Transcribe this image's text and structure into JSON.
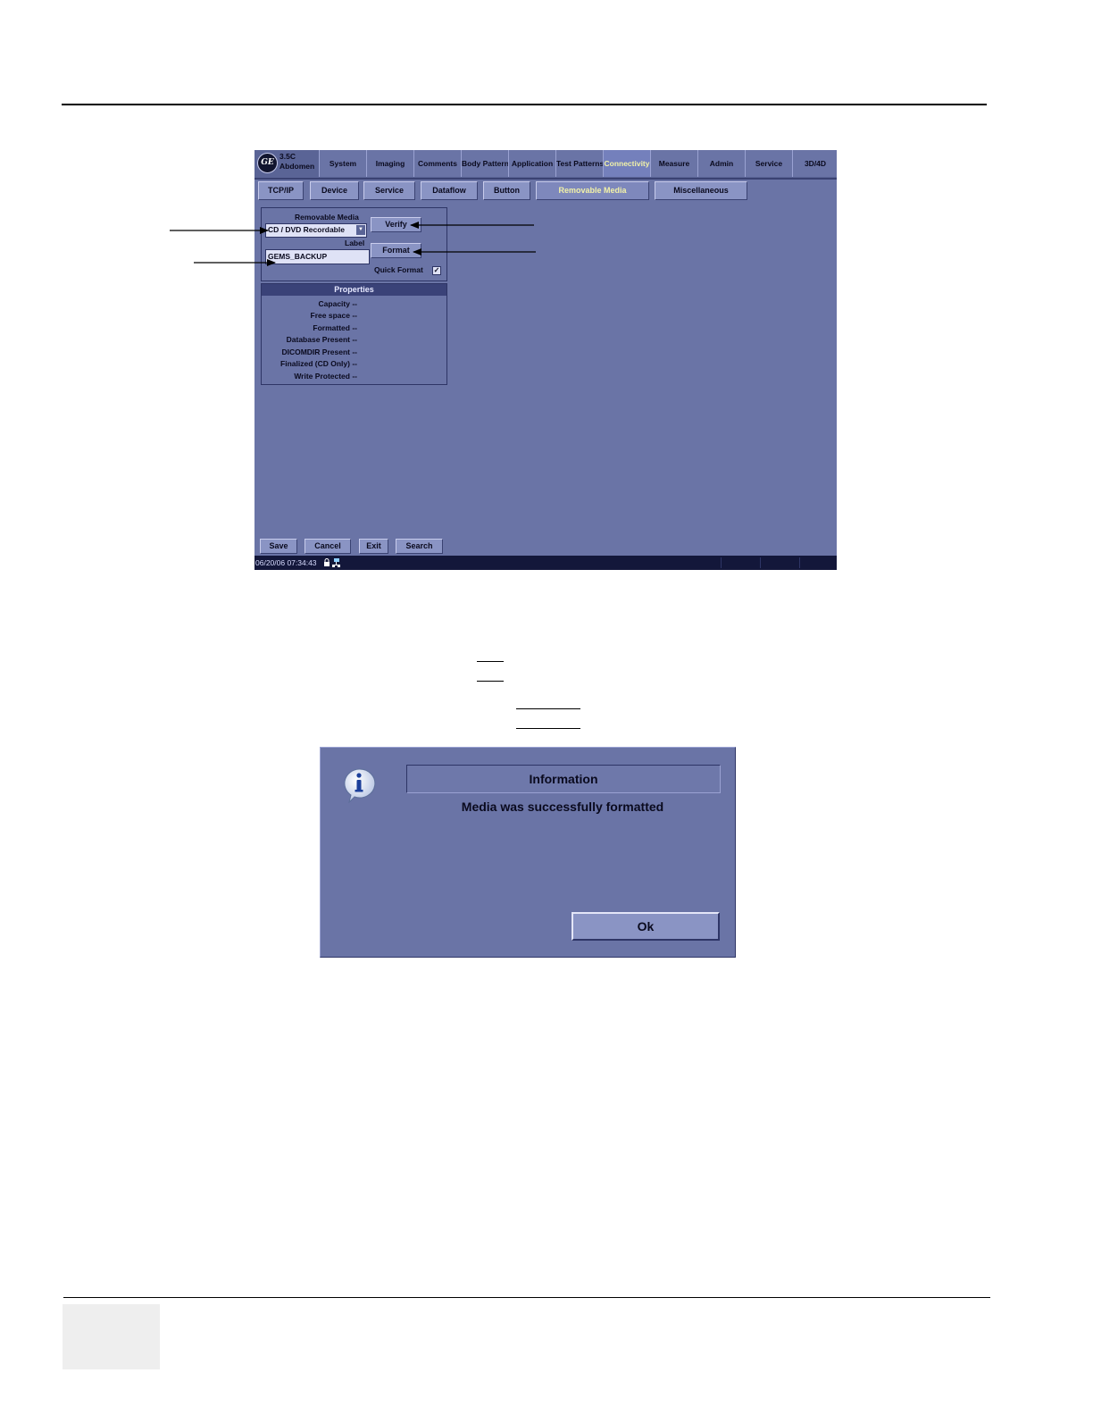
{
  "app": {
    "probe_line1": "3.5C",
    "probe_line2": "Abdomen",
    "tabs": [
      {
        "label": "System"
      },
      {
        "label": "Imaging"
      },
      {
        "label": "Comments"
      },
      {
        "label": "Body Patterns"
      },
      {
        "label": "Application"
      },
      {
        "label": "Test Patterns"
      },
      {
        "label": "Connectivity",
        "active": true
      },
      {
        "label": "Measure"
      },
      {
        "label": "Admin"
      },
      {
        "label": "Service"
      },
      {
        "label": "3D/4D"
      }
    ],
    "subtabs": [
      {
        "label": "TCP/IP"
      },
      {
        "label": "Device"
      },
      {
        "label": "Service"
      },
      {
        "label": "Dataflow"
      },
      {
        "label": "Button"
      },
      {
        "label": "Removable Media",
        "active": true
      },
      {
        "label": "Miscellaneous"
      }
    ],
    "removable_media": {
      "label": "Removable Media",
      "selected": "CD / DVD Recordable",
      "label_field_caption": "Label",
      "label_value": "GEMS_BACKUP",
      "verify_button": "Verify",
      "format_button": "Format",
      "quick_format_label": "Quick Format",
      "quick_format_mark": "✓"
    },
    "properties": {
      "header": "Properties",
      "rows": [
        "Capacity --",
        "Free space --",
        "Formatted --",
        "Database Present --",
        "DICOMDIR Present --",
        "Finalized (CD Only) --",
        "Write Protected --"
      ]
    },
    "bottom_buttons": {
      "save": "Save",
      "cancel": "Cancel",
      "exit": "Exit",
      "search": "Search"
    },
    "status": {
      "datetime": "06/20/06 07:34:43"
    }
  },
  "dialog": {
    "title": "Information",
    "message": "Media was successfully formatted",
    "ok_label": "Ok"
  },
  "colors": {
    "screen_bg": "#6a74a6",
    "active_tab_text": "#f2f2a8",
    "status_bar": "#13173a"
  }
}
